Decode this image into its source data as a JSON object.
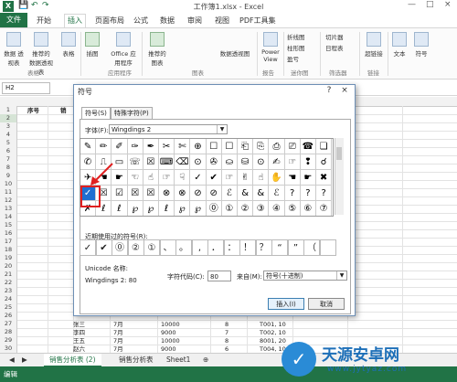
{
  "window": {
    "title": "工作簿1.xlsx - Excel",
    "app_icon": "X",
    "minimize": "—",
    "maximize": "□",
    "close": "×"
  },
  "quick_access": {
    "save_icon": "💾",
    "undo_icon": "↶",
    "redo_icon": "↷"
  },
  "menu": {
    "file": "文件",
    "items": [
      "开始",
      "插入",
      "页面布局",
      "公式",
      "数据",
      "审阅",
      "视图",
      "PDF工具集"
    ],
    "active": "插入"
  },
  "ribbon": {
    "buttons": [
      {
        "label": "数据\n透视表"
      },
      {
        "label": "推荐的\n数据透视表"
      },
      {
        "label": "表格"
      },
      {
        "label": "插图"
      },
      {
        "label": "Office\n应用程序"
      },
      {
        "label": "推荐的\n图表"
      },
      {
        "label": "数据透视图"
      },
      {
        "label": "Power\nView"
      },
      {
        "label": "切片器"
      },
      {
        "label": "日程表"
      },
      {
        "label": "超链接"
      },
      {
        "label": "文本"
      },
      {
        "label": "符号"
      }
    ],
    "small": [
      "折线图",
      "柱形图",
      "盈亏"
    ],
    "groups": [
      "表格",
      "应用程序",
      "图表",
      "报告",
      "迷你图",
      "筛选器",
      "链接"
    ]
  },
  "formula_bar": {
    "name_box": "H2",
    "fx": "fx"
  },
  "sheet": {
    "header_row": {
      "col_a": "序号",
      "col_b": "销"
    },
    "row_numbers": [
      "1",
      "2",
      "3",
      "4",
      "5",
      "6",
      "7",
      "8",
      "9",
      "10",
      "11",
      "12",
      "13",
      "14",
      "15",
      "16",
      "17",
      "18",
      "19",
      "20",
      "21",
      "22",
      "23",
      "24",
      "25",
      "26",
      "27",
      "28",
      "29",
      "30"
    ],
    "bottom_rows": [
      [
        "张三",
        "7月",
        "10000",
        "8",
        "T001, 10"
      ],
      [
        "李四",
        "7月",
        "9000",
        "7",
        "T002, 10"
      ],
      [
        "王五",
        "7月",
        "10000",
        "8",
        "8001, 20"
      ],
      [
        "赵六",
        "7月",
        "9000",
        "6",
        "T004, 10"
      ]
    ],
    "left_cells": [
      "张三",
      "李四",
      "王五",
      "赵六"
    ]
  },
  "sheet_tabs": [
    "销售分析表 (2)",
    "销售分析表",
    "Sheet1"
  ],
  "status": "编辑",
  "dialog": {
    "title": "符号",
    "close": "?",
    "close_x": "×",
    "tabs": [
      "符号(S)",
      "特殊字符(P)"
    ],
    "font_label": "字体(F):",
    "font_value": "Wingdings 2",
    "symbols": [
      [
        "✎",
        "✏",
        "✐",
        "✑",
        "✒",
        "✂",
        "✄",
        "⊕",
        "☐",
        "☐",
        "⎗",
        "⎘",
        "⎙",
        "⎚",
        "☎",
        "❏"
      ],
      [
        "✆",
        "⎍",
        "▭",
        "☏",
        "☒",
        "⌨",
        "⌫",
        "⊙",
        "✇",
        "⛀",
        "⛁",
        "⊙",
        "✍",
        "☞",
        "❢",
        "☌"
      ],
      [
        "✈",
        "☚",
        "☛",
        "☜",
        "☝",
        "☞",
        "☟",
        "✓",
        "✔",
        "☞",
        "✌",
        "☝",
        "✋",
        "☚",
        "☛",
        "✖"
      ],
      [
        "✓",
        "☒",
        "☑",
        "☒",
        "☒",
        "⊗",
        "⊗",
        "⊘",
        "⊘",
        "ℰ",
        "&",
        "&",
        "ℰ",
        "?",
        "?",
        "?"
      ],
      [
        "✗",
        "ℓ",
        "ℓ",
        "℘",
        "℘",
        "ℓ",
        "℘",
        "℘",
        "⓪",
        "①",
        "②",
        "③",
        "④",
        "⑤",
        "⑥",
        "⑦"
      ]
    ],
    "recent_label": "近期使用过的符号(R):",
    "recent": [
      "✓",
      "✔",
      "⓪",
      "②",
      "①",
      "、",
      "。",
      ",",
      "．",
      "：",
      "！",
      "？",
      "“",
      "”",
      "（",
      ""
    ],
    "unicode_label": "Unicode 名称:",
    "unicode_value": "Wingdings 2: 80",
    "charcode_label": "字符代码(C):",
    "charcode_value": "80",
    "from_label": "来自(M):",
    "from_value": "符号(十进制)",
    "insert": "插入(I)",
    "cancel": "取消"
  },
  "watermark": {
    "name": "天源安卓网",
    "url": "www.jytyaz.com"
  }
}
